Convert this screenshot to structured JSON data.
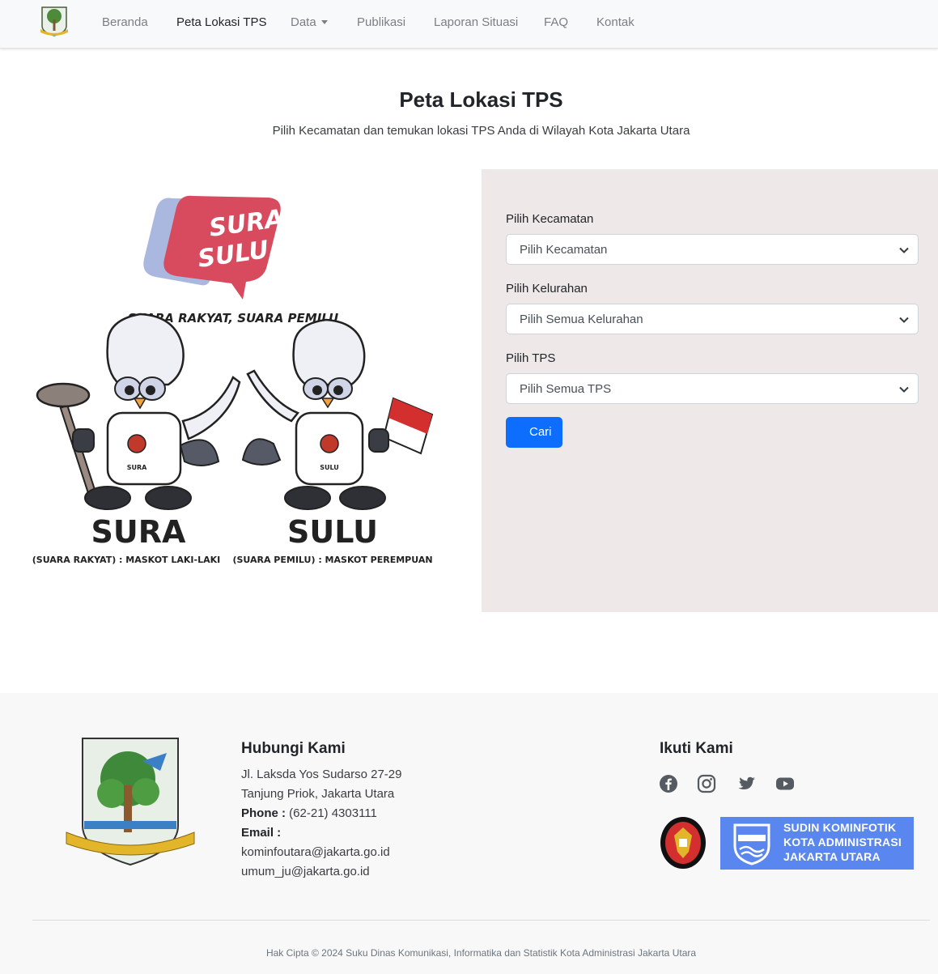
{
  "navbar": {
    "items": [
      {
        "label": "Beranda",
        "active": false
      },
      {
        "label": "Peta Lokasi TPS",
        "active": true
      },
      {
        "label": "Data",
        "active": false,
        "dropdown": true
      },
      {
        "label": "Publikasi",
        "active": false
      },
      {
        "label": "Laporan Situasi",
        "active": false
      },
      {
        "label": "FAQ",
        "active": false
      },
      {
        "label": "Kontak",
        "active": false
      }
    ]
  },
  "hero": {
    "title": "Peta Lokasi TPS",
    "subtitle": "Pilih Kecamatan dan temukan lokasi TPS Anda di Wilayah Kota Jakarta Utara"
  },
  "mascot": {
    "brand_line1": "SURA",
    "brand_line2": "SULU",
    "tagline": "SUARA RAKYAT, SUARA PEMILU",
    "left_name": "SURA",
    "left_caption": "(SUARA RAKYAT) : MASKOT LAKI-LAKI",
    "right_name": "SULU",
    "right_caption": "(SUARA PEMILU) : MASKOT PEREMPUAN",
    "shirt_left": "SURA",
    "shirt_right": "SULU"
  },
  "form": {
    "kecamatan_label": "Pilih Kecamatan",
    "kecamatan_value": "Pilih Kecamatan",
    "kelurahan_label": "Pilih Kelurahan",
    "kelurahan_value": "Pilih Semua Kelurahan",
    "tps_label": "Pilih TPS",
    "tps_value": "Pilih Semua TPS",
    "search_icon": "",
    "search_label": "Cari"
  },
  "footer": {
    "contact_heading": "Hubungi Kami",
    "address1": "Jl. Laksda Yos Sudarso 27-29",
    "address2": "Tanjung Priok, Jakarta Utara",
    "phone_label": "Phone :",
    "phone_value": "(62-21) 4303111",
    "email_label": "Email :",
    "email1": "kominfoutara@jakarta.go.id",
    "email2": "umum_ju@jakarta.go.id",
    "follow_heading": "Ikuti Kami",
    "social_icons": [
      "facebook-icon",
      "instagram-icon",
      "twitter-icon",
      "youtube-icon"
    ],
    "kominfo_line1": "SUDIN KOMINFOTIK",
    "kominfo_line2": "KOTA ADMINISTRASI",
    "kominfo_line3": "JAKARTA UTARA",
    "copyright": "Hak Cipta © 2024 Suku Dinas Komunikasi, Informatika dan Statistik Kota Administrasi Jakarta Utara"
  },
  "colors": {
    "primary": "#0d6efd",
    "panel_bg": "#eee8e8",
    "kominfo_bg": "#5a86f0",
    "mascot_red": "#d84a5e",
    "mascot_lavender": "#aab8e0"
  }
}
